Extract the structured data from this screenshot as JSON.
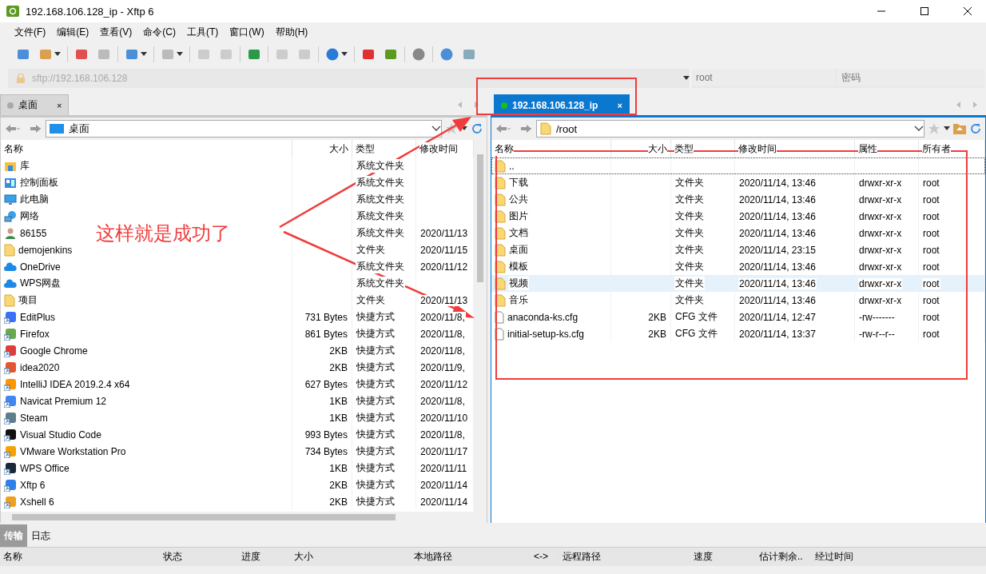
{
  "window": {
    "title": "192.168.106.128_ip - Xftp 6"
  },
  "menu": [
    "文件(F)",
    "编辑(E)",
    "查看(V)",
    "命令(C)",
    "工具(T)",
    "窗口(W)",
    "帮助(H)"
  ],
  "address": {
    "url": "sftp://192.168.106.128",
    "user_placeholder": "root",
    "password_placeholder": "密码"
  },
  "left_pane": {
    "tabs": [
      {
        "label": "桌面",
        "selected": false,
        "close": "×"
      }
    ],
    "path": "桌面",
    "columns": [
      "名称",
      "大小",
      "类型",
      "修改时间"
    ],
    "rows": [
      {
        "kind": "library",
        "name": "库",
        "type": "系统文件夹"
      },
      {
        "kind": "panel",
        "name": "控制面板",
        "type": "系统文件夹"
      },
      {
        "kind": "computer",
        "name": "此电脑",
        "type": "系统文件夹"
      },
      {
        "kind": "network",
        "name": "网络",
        "type": "系统文件夹"
      },
      {
        "kind": "user",
        "name": "86155",
        "type": "系统文件夹",
        "modified": "2020/11/13"
      },
      {
        "kind": "folder",
        "name": "demojenkins",
        "type": "文件夹",
        "modified": "2020/11/15"
      },
      {
        "kind": "cloud",
        "name": "OneDrive",
        "type": "系统文件夹",
        "modified": "2020/11/12"
      },
      {
        "kind": "cloud",
        "name": "WPS网盘",
        "type": "系统文件夹"
      },
      {
        "kind": "folder",
        "name": "项目",
        "type": "文件夹",
        "modified": "2020/11/13"
      },
      {
        "kind": "shortcut",
        "name": "EditPlus",
        "size": "731 Bytes",
        "type": "快捷方式",
        "modified": "2020/11/8,"
      },
      {
        "kind": "shortcut",
        "name": "Firefox",
        "size": "861 Bytes",
        "type": "快捷方式",
        "modified": "2020/11/8,"
      },
      {
        "kind": "shortcut",
        "name": "Google Chrome",
        "size": "2KB",
        "type": "快捷方式",
        "modified": "2020/11/8,"
      },
      {
        "kind": "shortcut",
        "name": "idea2020",
        "size": "2KB",
        "type": "快捷方式",
        "modified": "2020/11/9,"
      },
      {
        "kind": "shortcut",
        "name": "IntelliJ IDEA 2019.2.4 x64",
        "size": "627 Bytes",
        "type": "快捷方式",
        "modified": "2020/11/12"
      },
      {
        "kind": "shortcut",
        "name": "Navicat Premium 12",
        "size": "1KB",
        "type": "快捷方式",
        "modified": "2020/11/8,"
      },
      {
        "kind": "shortcut",
        "name": "Steam",
        "size": "1KB",
        "type": "快捷方式",
        "modified": "2020/11/10"
      },
      {
        "kind": "shortcut",
        "name": "Visual Studio Code",
        "size": "993 Bytes",
        "type": "快捷方式",
        "modified": "2020/11/8,"
      },
      {
        "kind": "shortcut",
        "name": "VMware Workstation Pro",
        "size": "734 Bytes",
        "type": "快捷方式",
        "modified": "2020/11/17"
      },
      {
        "kind": "shortcut",
        "name": "WPS Office",
        "size": "1KB",
        "type": "快捷方式",
        "modified": "2020/11/11"
      },
      {
        "kind": "shortcut",
        "name": "Xftp 6",
        "size": "2KB",
        "type": "快捷方式",
        "modified": "2020/11/14"
      },
      {
        "kind": "shortcut",
        "name": "Xshell 6",
        "size": "2KB",
        "type": "快捷方式",
        "modified": "2020/11/14"
      }
    ]
  },
  "right_pane": {
    "tabs": [
      {
        "label": "192.168.106.128_ip",
        "selected": true,
        "connected": true,
        "close": "×"
      }
    ],
    "path": "/root",
    "columns": [
      "名称",
      "大小",
      "类型",
      "修改时间",
      "属性",
      "所有者"
    ],
    "rows": [
      {
        "kind": "folder",
        "name": "..",
        "selected": false,
        "focused": true
      },
      {
        "kind": "folder",
        "name": "下载",
        "type": "文件夹",
        "modified": "2020/11/14, 13:46",
        "permissions": "drwxr-xr-x",
        "owner": "root",
        "selected": false,
        "focused": false
      },
      {
        "kind": "folder",
        "name": "公共",
        "type": "文件夹",
        "modified": "2020/11/14, 13:46",
        "permissions": "drwxr-xr-x",
        "owner": "root",
        "selected": false,
        "focused": false
      },
      {
        "kind": "folder",
        "name": "图片",
        "type": "文件夹",
        "modified": "2020/11/14, 13:46",
        "permissions": "drwxr-xr-x",
        "owner": "root",
        "selected": false,
        "focused": false
      },
      {
        "kind": "folder",
        "name": "文档",
        "type": "文件夹",
        "modified": "2020/11/14, 13:46",
        "permissions": "drwxr-xr-x",
        "owner": "root",
        "selected": false,
        "focused": false
      },
      {
        "kind": "folder",
        "name": "桌面",
        "type": "文件夹",
        "modified": "2020/11/14, 23:15",
        "permissions": "drwxr-xr-x",
        "owner": "root",
        "selected": false,
        "focused": false
      },
      {
        "kind": "folder",
        "name": "模板",
        "type": "文件夹",
        "modified": "2020/11/14, 13:46",
        "permissions": "drwxr-xr-x",
        "owner": "root",
        "selected": false,
        "focused": false
      },
      {
        "kind": "folder",
        "name": "视频",
        "type": "文件夹",
        "modified": "2020/11/14, 13:46",
        "permissions": "drwxr-xr-x",
        "owner": "root",
        "selected": true,
        "focused": false
      },
      {
        "kind": "folder",
        "name": "音乐",
        "type": "文件夹",
        "modified": "2020/11/14, 13:46",
        "permissions": "drwxr-xr-x",
        "owner": "root",
        "selected": false,
        "focused": false
      },
      {
        "kind": "file",
        "name": "anaconda-ks.cfg",
        "size": "2KB",
        "type": "CFG 文件",
        "modified": "2020/11/14, 12:47",
        "permissions": "-rw-------",
        "owner": "root",
        "selected": false,
        "focused": false
      },
      {
        "kind": "file",
        "name": "initial-setup-ks.cfg",
        "size": "2KB",
        "type": "CFG 文件",
        "modified": "2020/11/14, 13:37",
        "permissions": "-rw-r--r--",
        "owner": "root",
        "selected": false,
        "focused": false
      }
    ]
  },
  "transfer": {
    "tabs": [
      {
        "label": "传输",
        "selected": true
      },
      {
        "label": "日志",
        "selected": false
      }
    ],
    "columns": [
      "名称",
      "状态",
      "进度",
      "大小",
      "本地路径",
      "<->",
      "远程路径",
      "速度",
      "估计剩余..",
      "经过时间"
    ]
  },
  "annotation": {
    "text": "这样就是成功了"
  }
}
